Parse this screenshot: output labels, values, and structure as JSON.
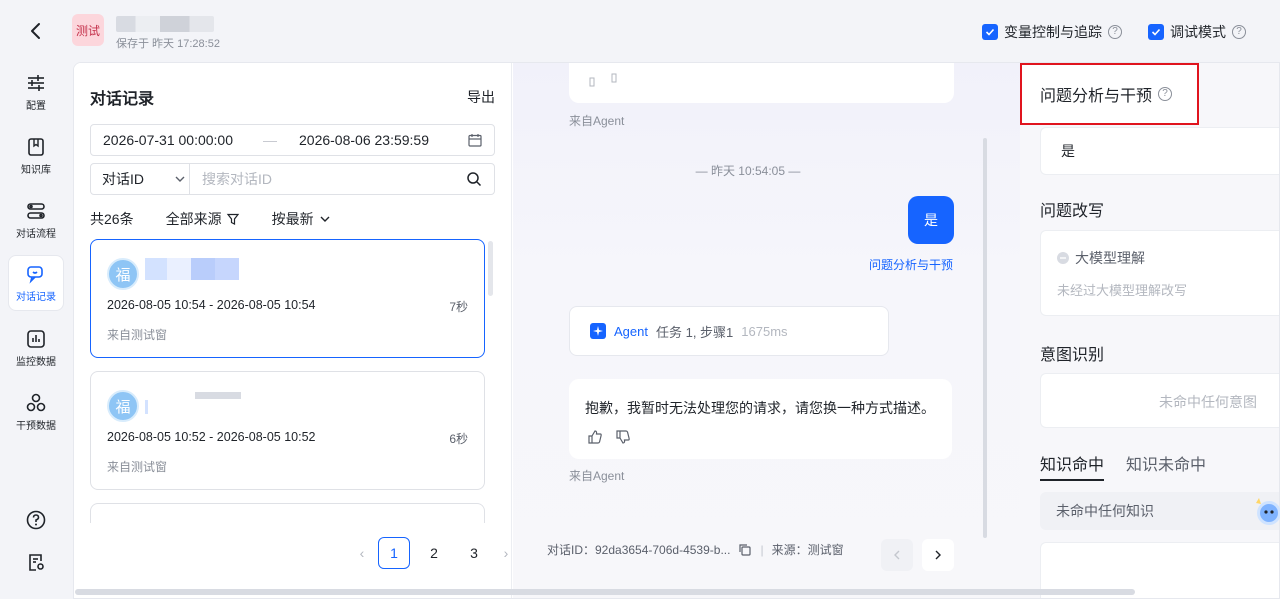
{
  "header": {
    "app_badge": "测试",
    "save_time": "保存于 昨天 17:28:52",
    "var_control_label": "变量控制与追踪",
    "debug_mode_label": "调试模式"
  },
  "nav": {
    "items": [
      {
        "label": "配置"
      },
      {
        "label": "知识库"
      },
      {
        "label": "对话流程"
      },
      {
        "label": "对话记录"
      },
      {
        "label": "监控数据"
      },
      {
        "label": "干预数据"
      }
    ]
  },
  "records": {
    "title": "对话记录",
    "export": "导出",
    "date_start": "2026-07-31 00:00:00",
    "date_sep": "—",
    "date_end": "2026-08-06 23:59:59",
    "search_type": "对话ID",
    "search_placeholder": "搜索对话ID",
    "total": "共26条",
    "source_filter": "全部来源",
    "sort": "按最新",
    "items": [
      {
        "avatar": "福",
        "time": "2026-08-05 10:54 - 2026-08-05 10:54",
        "duration": "7秒",
        "source": "来自测试窗"
      },
      {
        "avatar": "福",
        "time": "2026-08-05 10:52 - 2026-08-05 10:52",
        "duration": "6秒",
        "source": "来自测试窗"
      }
    ],
    "pages": [
      "1",
      "2",
      "3"
    ]
  },
  "chat": {
    "from_agent_1": "来自Agent",
    "time_sep": "— 昨天 10:54:05 —",
    "user_msg": "是",
    "user_tag": "问题分析与干预",
    "agent_name": "Agent",
    "agent_step": "任务 1, 步骤1",
    "agent_ms": "1675ms",
    "reply": "抱歉，我暂时无法处理您的请求，请您换一种方式描述。",
    "from_agent_2": "来自Agent",
    "conv_id": "对话ID：92da3654-706d-4539-b...",
    "source": "来源：测试窗"
  },
  "analysis": {
    "title": "问题分析与干预",
    "answer": "是",
    "rewrite_title": "问题改写",
    "llm_label": "大模型理解",
    "llm_desc": "未经过大模型理解改写",
    "intent_title": "意图识别",
    "intent_empty": "未命中任何意图",
    "tab_hit": "知识命中",
    "tab_miss": "知识未命中",
    "knowledge_empty": "未命中任何知识"
  }
}
